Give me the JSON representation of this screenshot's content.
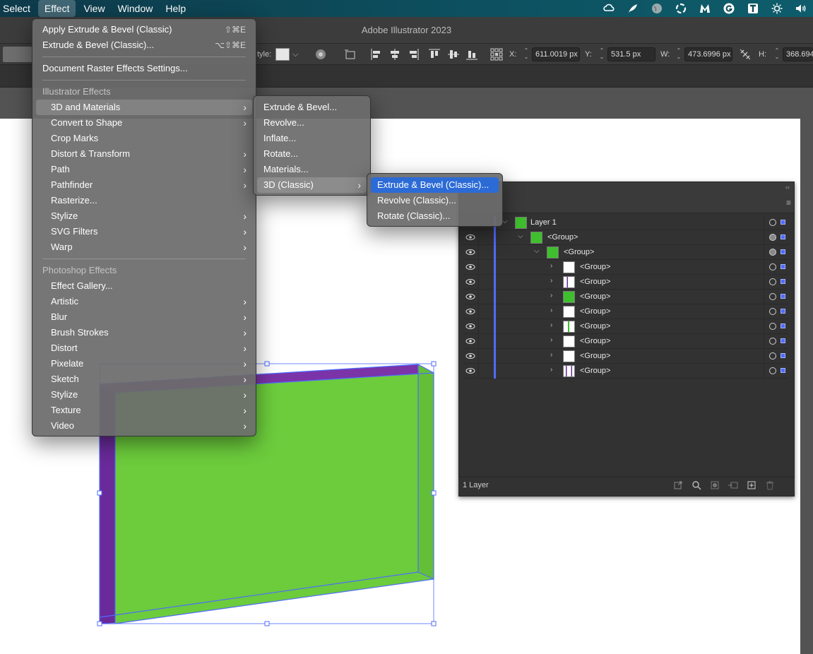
{
  "menubar": {
    "items": [
      "Select",
      "Effect",
      "View",
      "Window",
      "Help"
    ],
    "active": "Effect",
    "status_icons": [
      "creative-cloud-icon",
      "feather-icon",
      "globe-icon",
      "sync-icon",
      "malwarebytes-icon",
      "grammarly-icon",
      "text-icon",
      "brightness-icon",
      "volume-icon"
    ]
  },
  "app": {
    "title": "Adobe Illustrator 2023"
  },
  "controlbar": {
    "style_label": "tyle:",
    "x_label": "X:",
    "x_value": "611.0019 px",
    "y_label": "Y:",
    "y_value": "531.5 px",
    "w_label": "W:",
    "w_value": "473.6996 px",
    "h_label": "H:",
    "h_value": "368.694"
  },
  "effect_menu": {
    "apply_last": {
      "label": "Apply Extrude & Bevel (Classic)",
      "shortcut": "⇧⌘E"
    },
    "last_effect": {
      "label": "Extrude & Bevel (Classic)...",
      "shortcut": "⌥⇧⌘E"
    },
    "raster_settings": "Document Raster Effects Settings...",
    "illustrator_header": "Illustrator Effects",
    "illustrator_items": [
      {
        "label": "3D and Materials",
        "submenu": true,
        "highlighted": true
      },
      {
        "label": "Convert to Shape",
        "submenu": true
      },
      {
        "label": "Crop Marks",
        "submenu": false
      },
      {
        "label": "Distort & Transform",
        "submenu": true
      },
      {
        "label": "Path",
        "submenu": true
      },
      {
        "label": "Pathfinder",
        "submenu": true
      },
      {
        "label": "Rasterize...",
        "submenu": false
      },
      {
        "label": "Stylize",
        "submenu": true
      },
      {
        "label": "SVG Filters",
        "submenu": true
      },
      {
        "label": "Warp",
        "submenu": true
      }
    ],
    "photoshop_header": "Photoshop Effects",
    "photoshop_items": [
      {
        "label": "Effect Gallery...",
        "submenu": false
      },
      {
        "label": "Artistic",
        "submenu": true
      },
      {
        "label": "Blur",
        "submenu": true
      },
      {
        "label": "Brush Strokes",
        "submenu": true
      },
      {
        "label": "Distort",
        "submenu": true
      },
      {
        "label": "Pixelate",
        "submenu": true
      },
      {
        "label": "Sketch",
        "submenu": true
      },
      {
        "label": "Stylize",
        "submenu": true
      },
      {
        "label": "Texture",
        "submenu": true
      },
      {
        "label": "Video",
        "submenu": true
      }
    ]
  },
  "submenu_3d": {
    "items": [
      "Extrude & Bevel...",
      "Revolve...",
      "Inflate...",
      "Rotate...",
      "Materials..."
    ],
    "classic": "3D (Classic)"
  },
  "submenu_classic": {
    "items": [
      "Extrude & Bevel (Classic)...",
      "Revolve (Classic)...",
      "Rotate (Classic)..."
    ],
    "highlighted": "Extrude & Bevel (Classic)..."
  },
  "layers_panel": {
    "rows": [
      {
        "name": "Layer 1",
        "level": 0
      },
      {
        "name": "<Group>",
        "level": 1
      },
      {
        "name": "<Group>",
        "level": 2
      },
      {
        "name": "<Group>",
        "level": 3
      },
      {
        "name": "<Group>",
        "level": 3
      },
      {
        "name": "<Group>",
        "level": 3
      },
      {
        "name": "<Group>",
        "level": 3
      },
      {
        "name": "<Group>",
        "level": 3
      },
      {
        "name": "<Group>",
        "level": 3
      },
      {
        "name": "<Group>",
        "level": 3
      },
      {
        "name": "<Group>",
        "level": 3
      }
    ],
    "footer_count": "1 Layer"
  },
  "colors": {
    "extrude_front": "#6ccc3c",
    "extrude_side": "#6a2a9a",
    "selection": "#4f6bff",
    "menu_highlight": "#2c6bd6"
  }
}
